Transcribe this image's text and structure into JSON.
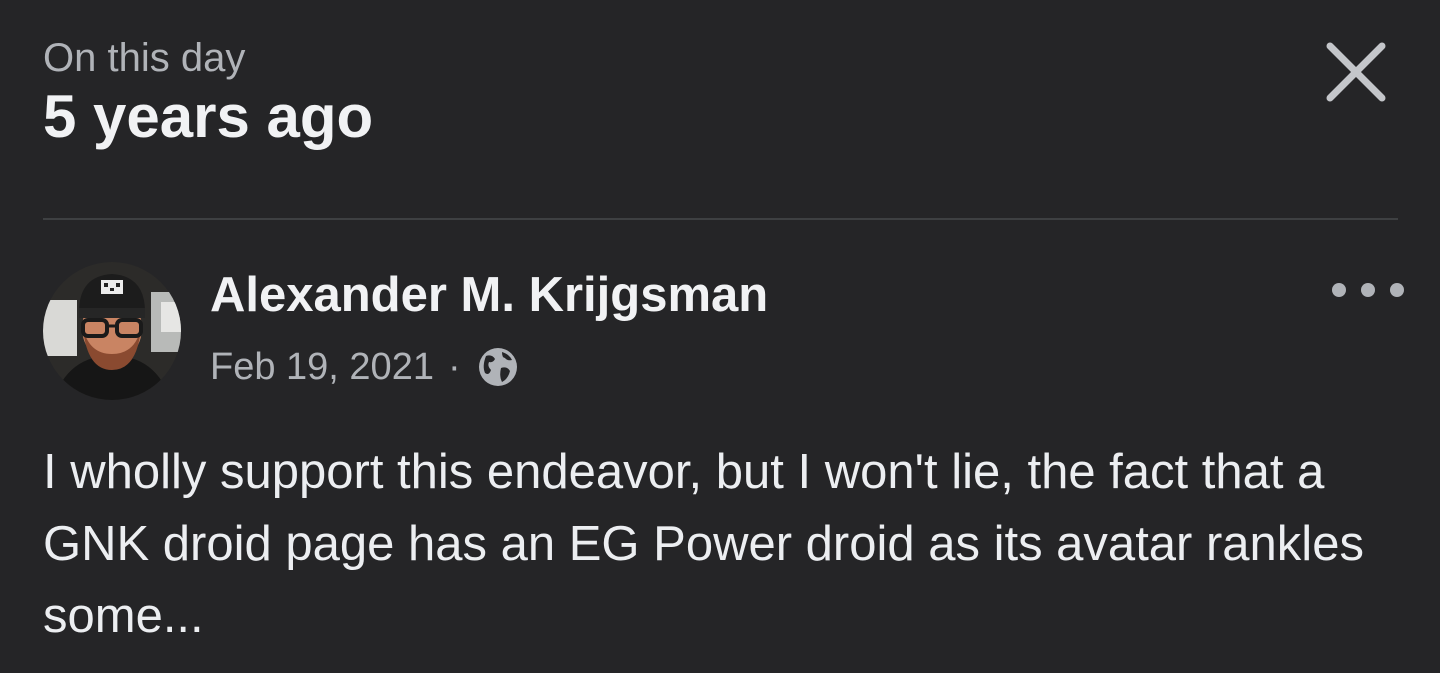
{
  "header": {
    "eyebrow": "On this day",
    "title": "5 years ago",
    "close_icon": "close-icon"
  },
  "post": {
    "author": "Alexander M. Krijgsman",
    "date": "Feb 19, 2021",
    "separator": "·",
    "privacy_icon": "globe-icon",
    "menu_icon": "more-options-icon",
    "text": "I wholly support this endeavor, but I won't lie, the fact that a GNK droid page has an EG Power droid as its avatar rankles some..."
  },
  "colors": {
    "background": "#252527",
    "primary_text": "#f1f2f4",
    "secondary_text": "#b0b3b8",
    "divider": "#3e4042"
  }
}
